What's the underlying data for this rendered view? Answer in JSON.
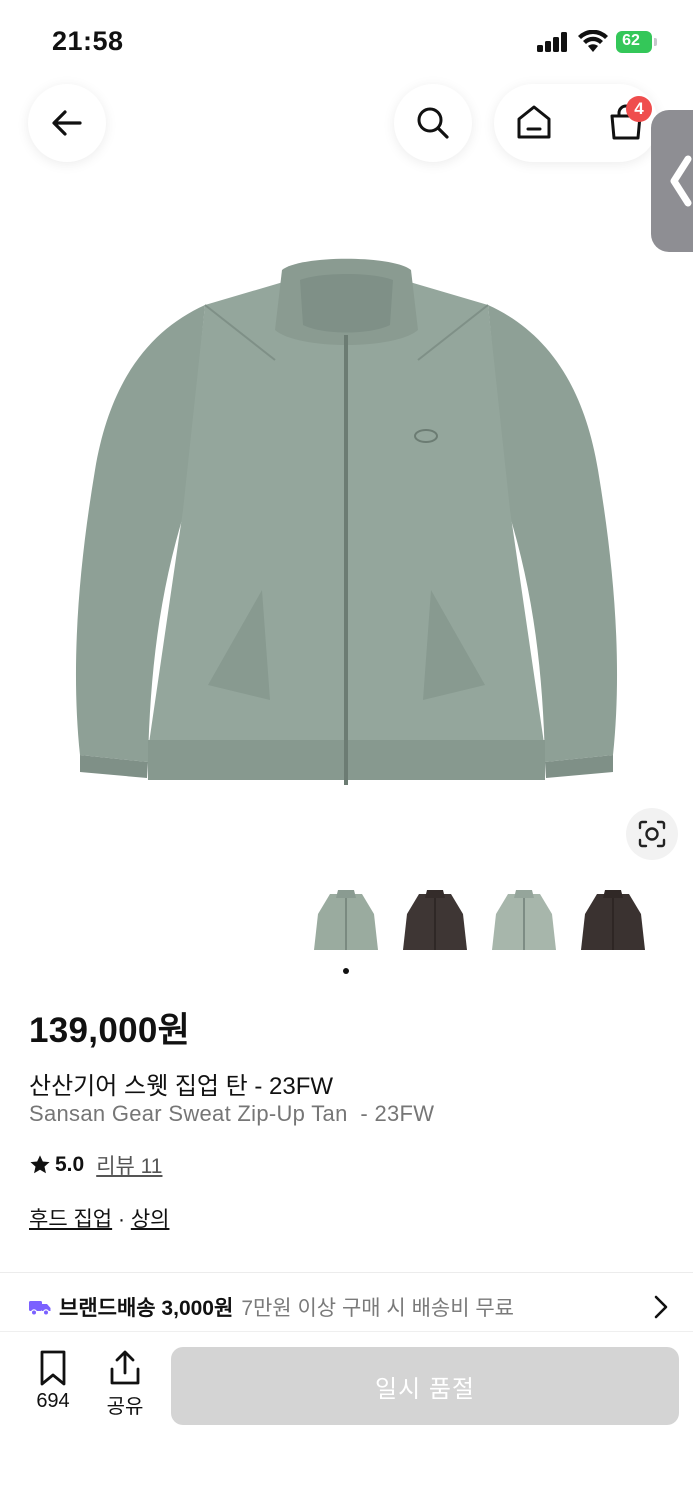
{
  "status_bar": {
    "time": "21:58",
    "battery": "62"
  },
  "nav": {
    "cart_count": "4"
  },
  "colors": {
    "accent_badge": "#ef4d4d",
    "soldout_bg": "#d4d4d4",
    "battery_green": "#34c759",
    "shipping_icon": "#7b61ff"
  },
  "product": {
    "price": "139,000원",
    "name_ko": "산산기어 스웻 집업 탄 - 23FW",
    "name_en": "Sansan Gear Sweat Zip-Up Tan  - 23FW",
    "rating": "5.0",
    "review_label": "리뷰 11",
    "category_1": "후드 집업",
    "category_sep": "·",
    "category_2": "상의"
  },
  "gallery": {
    "thumbnails": [
      "green-zip-up",
      "brown-zip-up",
      "green-zip-up",
      "brown-zip-up"
    ],
    "current_index": 0
  },
  "shipping": {
    "title": "브랜드배송 3,000원",
    "note": "7만원 이상 구매 시 배송비 무료"
  },
  "bottom_bar": {
    "save_count": "694",
    "share_label": "공유",
    "buy_label": "일시 품절"
  }
}
